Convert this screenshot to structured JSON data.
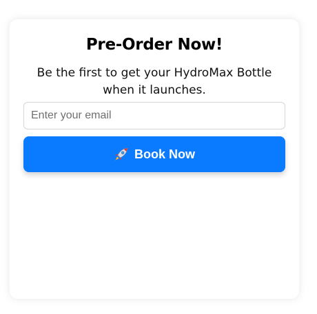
{
  "card": {
    "title": "Pre-Order Now!",
    "subtitle": "Be the first to get your HydroMax Bottle when it launches."
  },
  "form": {
    "email_placeholder": "Enter your email",
    "email_value": "",
    "submit_label": "Book Now",
    "submit_icon": "rocket-icon"
  },
  "colors": {
    "accent": "#0a7bff",
    "card_background": "#ffffff",
    "text": "#000000"
  }
}
